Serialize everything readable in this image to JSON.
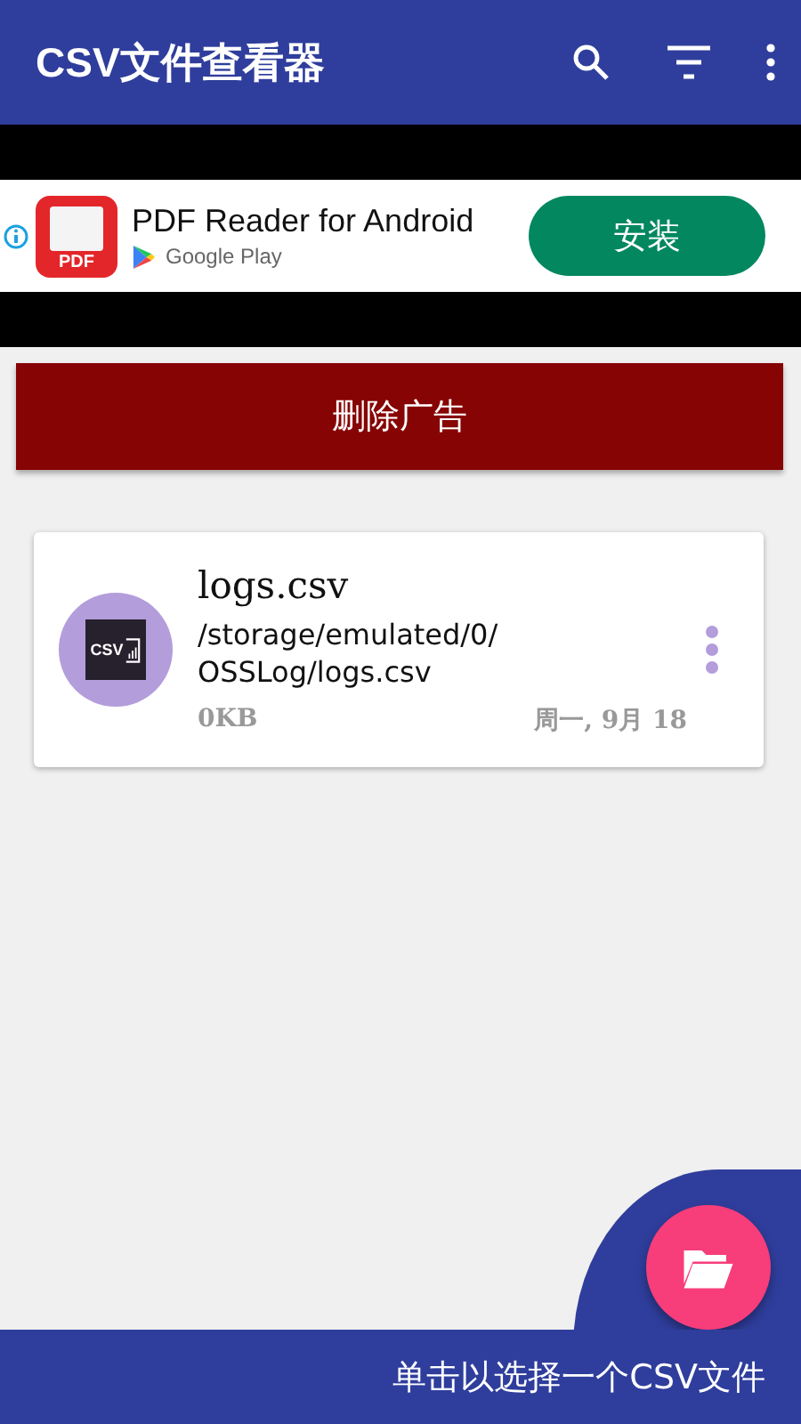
{
  "app_bar": {
    "title": "CSV文件查看器"
  },
  "ad": {
    "app_icon_label": "PDF",
    "title": "PDF Reader for Android",
    "store": "Google Play",
    "install_button": "安装"
  },
  "remove_ads_button": "删除广告",
  "files": [
    {
      "icon_label": "CSV",
      "name": "logs.csv",
      "path": "/storage/emulated/0/\nOSSLog/logs.csv",
      "size": "0KB",
      "date": "周一, 9月 18"
    }
  ],
  "bottom_bar": {
    "hint": "单击以选择一个CSV文件"
  }
}
